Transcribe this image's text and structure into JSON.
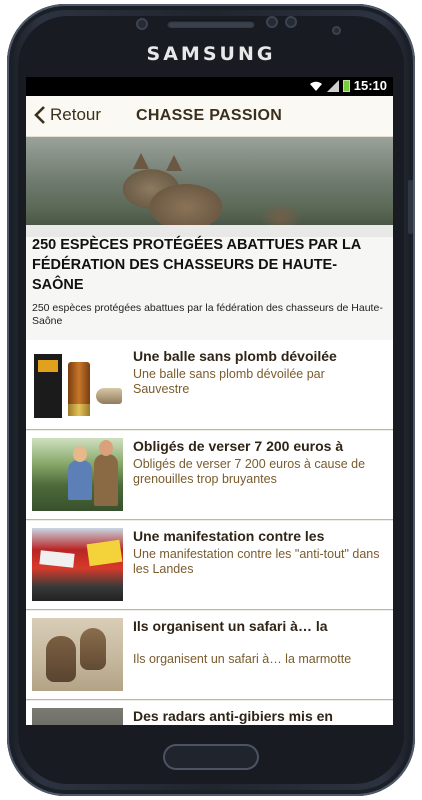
{
  "device": {
    "brand": "SAMSUNG"
  },
  "status_bar": {
    "time": "15:10"
  },
  "header": {
    "back_label": "Retour",
    "title": "CHASSE PASSION"
  },
  "hero": {
    "title": "250 ESPÈCES PROTÉGÉES ABATTUES PAR LA FÉDÉRATION DES CHASSEURS DE HAUTE-SAÔNE",
    "subtitle": "250 espèces protégées abattues par la fédération des chasseurs de Haute-Saône"
  },
  "articles": [
    {
      "title": "Une balle sans plomb dévoilée",
      "summary": "Une balle sans plomb dévoilée par Sauvestre"
    },
    {
      "title": "Obligés de verser 7 200 euros à",
      "summary": "Obligés de verser 7 200 euros à cause de grenouilles trop bruyantes"
    },
    {
      "title": "Une manifestation contre les",
      "summary": "Une manifestation contre les \"anti-tout\" dans les Landes"
    },
    {
      "title": "Ils organisent un safari à… la",
      "summary": "Ils organisent un safari à… la marmotte"
    },
    {
      "title": "Des radars anti-gibiers mis en",
      "summary": ""
    }
  ],
  "colors": {
    "accent_text": "#7a5c2e",
    "header_bg": "#fbf9f3",
    "title_text": "#3b2f1e"
  }
}
